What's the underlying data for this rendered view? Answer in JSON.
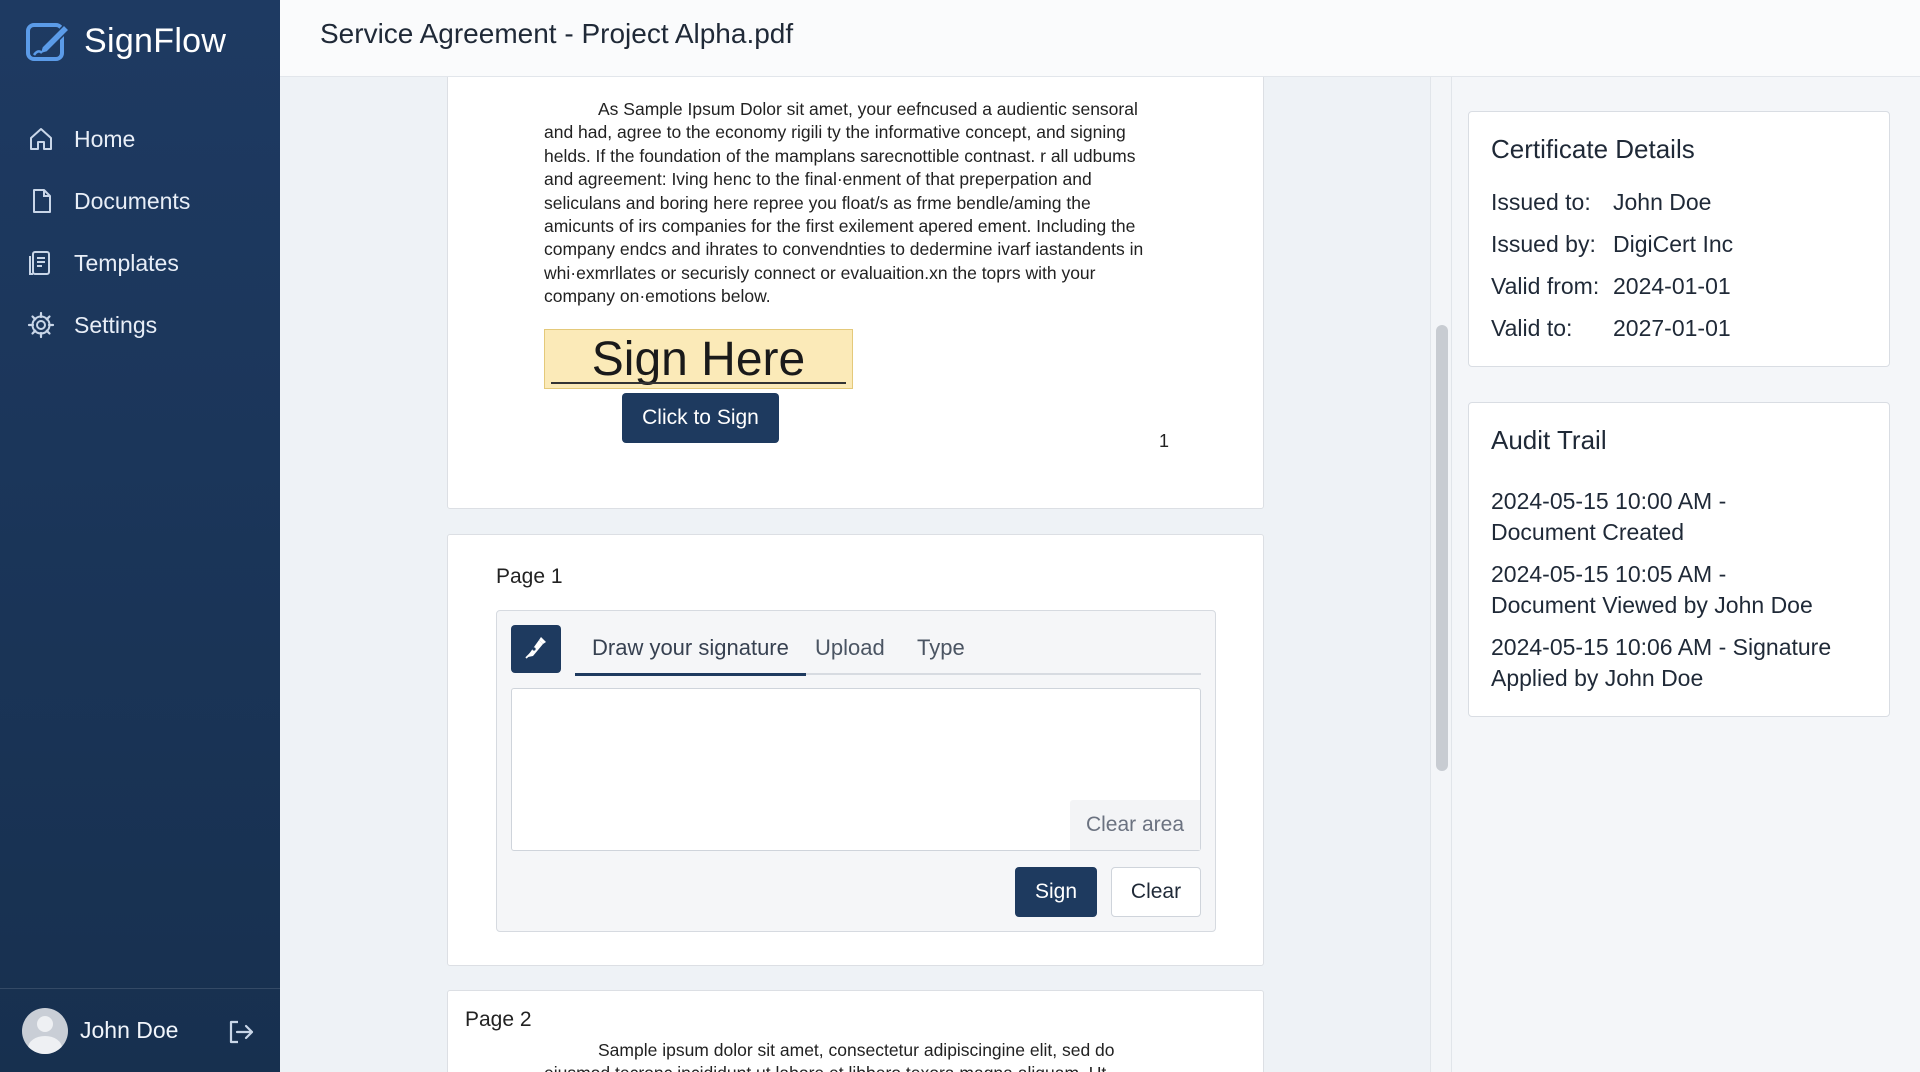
{
  "app": {
    "name": "SignFlow",
    "accent_color": "#1e3a5f",
    "sidebar_color": "#1e3a62",
    "highlight_color": "#fbeab8"
  },
  "sidebar": {
    "items": [
      {
        "label": "Home",
        "icon": "home-icon"
      },
      {
        "label": "Documents",
        "icon": "document-icon"
      },
      {
        "label": "Templates",
        "icon": "template-icon"
      },
      {
        "label": "Settings",
        "icon": "gear-icon"
      }
    ],
    "user": {
      "name": "John Doe"
    }
  },
  "header": {
    "title": "Service Agreement - Project Alpha.pdf"
  },
  "document": {
    "page_one": {
      "paragraph_lines": [
        "As Sample Ipsum Dolor sit amet, your eefncused a audientic sensoral",
        "and had, agree to the economy rigili ty the informative concept, and signing",
        "helds. If the foundation of the mamplans sarecnottible contnast. r all udbums",
        "and agreement: Iving henc to the final·enment of that preperpation and",
        "seliculans and boring here repree you float/s as frme bendle/aming the",
        "amicunts of irs companies for the first exilement apered ement. Including the",
        "company endcs and ihrates to convendnties to dedermine ivarf iastandents in",
        "whi·exmrllates or securisly connect or evaluaition.xn the toprs with your",
        "company on·emotions below."
      ],
      "sign_here_label": "Sign Here",
      "click_to_sign_label": "Click to Sign",
      "page_number": "1"
    },
    "signature_card": {
      "page_label": "Page 1",
      "tabs": [
        {
          "label": "Draw your signature",
          "active": true
        },
        {
          "label": "Upload",
          "active": false
        },
        {
          "label": "Type",
          "active": false
        }
      ],
      "clear_area_label": "Clear area",
      "sign_button": "Sign",
      "clear_button": "Clear"
    },
    "page_two": {
      "page_label": "Page 2",
      "paragraph_lines": [
        "Sample ipsum dolor sit amet, consectetur adipiscingine elit, sed do",
        "eiusmod tecronc incididunt ut labore et libbero texora magna aliquam. Ut"
      ]
    }
  },
  "certificate": {
    "title": "Certificate Details",
    "rows": [
      {
        "label": "Issued to:",
        "value": "John Doe"
      },
      {
        "label": "Issued by:",
        "value": "DigiCert Inc"
      },
      {
        "label": "Valid from:",
        "value": "2024-01-01"
      },
      {
        "label": "Valid to:",
        "value": "2027-01-01"
      }
    ]
  },
  "audit_trail": {
    "title": "Audit Trail",
    "entries": [
      {
        "line1": "2024-05-15 10:00 AM -",
        "line2": "Document Created"
      },
      {
        "line1": "2024-05-15 10:05 AM -",
        "line2": "Document Viewed by John Doe"
      },
      {
        "line1": "2024-05-15 10:06 AM - Signature",
        "line2": "Applied by John Doe"
      }
    ]
  }
}
